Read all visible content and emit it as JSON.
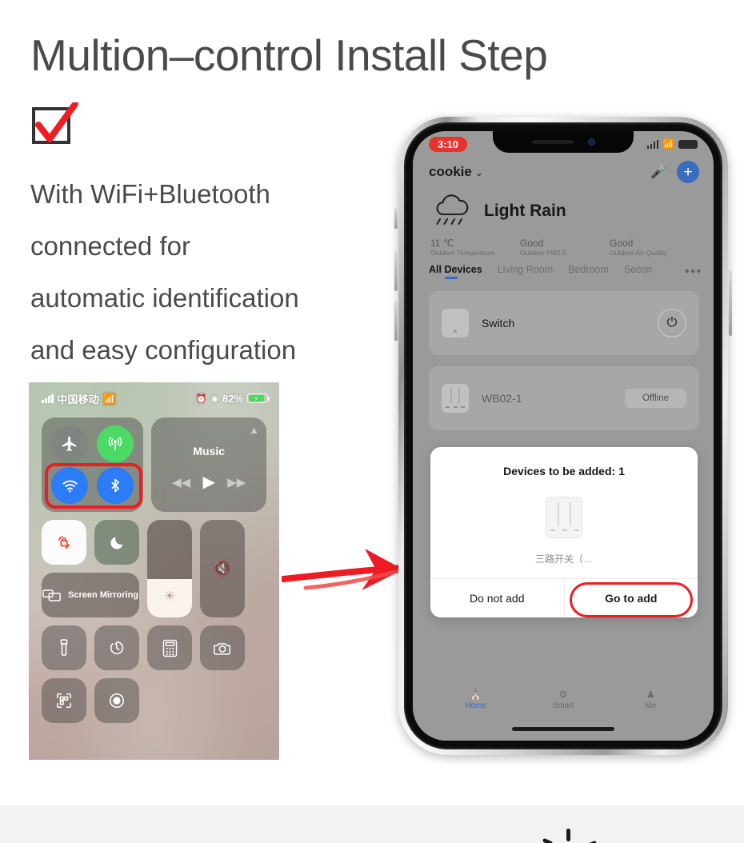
{
  "page": {
    "title": "Multion–control Install Step",
    "lead_lines": [
      "With WiFi+Bluetooth",
      "connected for",
      "automatic identification",
      "and easy configuration"
    ]
  },
  "control_center": {
    "status": {
      "carrier": "中国移动",
      "battery_percent": "82%",
      "signal_icon": "signal-bars-icon",
      "wifi_icon": "wifi-icon",
      "alarm_icon": "alarm-icon",
      "orientation_lock_icon": "rotation-lock-icon",
      "battery_icon": "battery-charging-icon"
    },
    "toggles": [
      {
        "name": "airplane-mode",
        "icon": "airplane-icon",
        "state": "off"
      },
      {
        "name": "cellular-data",
        "icon": "cellular-antenna-icon",
        "state": "on"
      },
      {
        "name": "wifi",
        "icon": "wifi-icon",
        "state": "on"
      },
      {
        "name": "bluetooth",
        "icon": "bluetooth-icon",
        "state": "on"
      }
    ],
    "highlight_color": "#ee1c22",
    "music": {
      "title": "Music",
      "airplay_icon": "airplay-icon",
      "prev_icon": "rewind-icon",
      "play_icon": "play-icon",
      "next_icon": "fast-forward-icon"
    },
    "tiles": [
      {
        "name": "rotation-lock",
        "icon": "rotation-lock-icon"
      },
      {
        "name": "do-not-disturb",
        "icon": "moon-icon"
      },
      {
        "name": "screen-mirroring",
        "icon": "screen-mirroring-icon",
        "label": "Screen Mirroring"
      },
      {
        "name": "brightness-slider",
        "icon": "brightness-icon"
      },
      {
        "name": "volume-slider",
        "icon": "mute-icon"
      },
      {
        "name": "flashlight",
        "icon": "flashlight-icon"
      },
      {
        "name": "timer",
        "icon": "timer-icon"
      },
      {
        "name": "calculator",
        "icon": "calculator-icon"
      },
      {
        "name": "camera",
        "icon": "camera-icon"
      },
      {
        "name": "qr-scanner",
        "icon": "qr-scan-icon"
      },
      {
        "name": "screen-record",
        "icon": "record-icon"
      }
    ]
  },
  "arrow": {
    "name": "red-arrow",
    "color": "#ee1c22"
  },
  "phone": {
    "status_bar": {
      "time": "3:10",
      "time_pill_color": "#e8332c",
      "signal_icon": "signal-bars-icon",
      "wifi_icon": "wifi-icon",
      "battery_icon": "battery-icon"
    },
    "header": {
      "home_name": "cookie",
      "caret": "⌄",
      "mic_icon": "microphone-icon",
      "add_icon": "plus-icon",
      "add_button_color": "#3a6dbf"
    },
    "weather": {
      "icon": "rain-cloud-icon",
      "condition": "Light Rain",
      "stats": [
        {
          "value": "11 ℃",
          "label": "Outdoor Temperature"
        },
        {
          "value": "Good",
          "label": "Outdoor PM2.5"
        },
        {
          "value": "Good",
          "label": "Outdoor Air Quality"
        }
      ]
    },
    "tabs": [
      {
        "label": "All Devices",
        "active": true
      },
      {
        "label": "Living Room",
        "active": false
      },
      {
        "label": "Bedroom",
        "active": false
      },
      {
        "label": "Secon",
        "active": false
      }
    ],
    "tabs_more": "•••",
    "tab_accent": "#2f6fd0",
    "devices": [
      {
        "name": "Switch",
        "action": "power-toggle",
        "action_icon": "power-icon",
        "status": ""
      },
      {
        "name": "WB02-1",
        "action": "status-badge",
        "action_icon": "",
        "status": "Offline"
      }
    ],
    "modal": {
      "title": "Devices to be added: 1",
      "device_icon": "three-gang-switch-icon",
      "device_label": "三路开关（…",
      "cancel_label": "Do not add",
      "confirm_label": "Go to add",
      "confirm_highlight_color": "#ee1c22"
    },
    "tabbar": [
      {
        "label": "Home",
        "icon": "home-icon",
        "active": true
      },
      {
        "label": "Smart",
        "icon": "smart-icon",
        "active": false
      },
      {
        "label": "Me",
        "icon": "person-icon",
        "active": false
      }
    ]
  }
}
